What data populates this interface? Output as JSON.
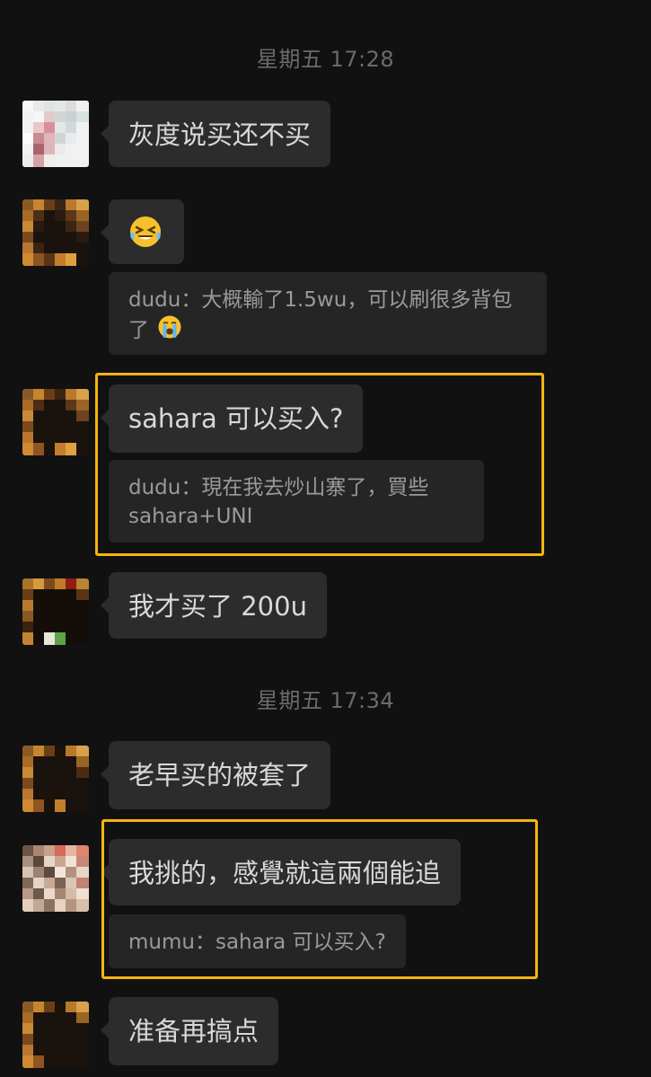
{
  "chat": {
    "timestamps": [
      "星期五 17:28",
      "星期五 17:34"
    ],
    "messages": [
      {
        "text": "灰度说买还不买"
      },
      {
        "text": ""
      },
      {
        "quote": "dudu：大概輸了1.5wu，可以刷很多背包了"
      },
      {
        "text": "sahara 可以买入?",
        "quote": "dudu：現在我去炒山寨了，買些sahara+UNI"
      },
      {
        "text": "我才买了 200u"
      },
      {
        "text": "老早买的被套了"
      },
      {
        "text": "我挑的，感覺就這兩個能追",
        "quote": "mumu：sahara 可以买入?"
      },
      {
        "text": "准备再搞点"
      }
    ]
  },
  "emoji": {
    "message_2": "grinning-squinting-tears-face",
    "quote_2_trailing": "loudly-crying-face"
  },
  "colors": {
    "background": "#111111",
    "bubble": "#2c2c2c",
    "quote_bubble": "#252525",
    "highlight_border": "#f5b50f",
    "timestamp_text": "#6b6b6b"
  }
}
